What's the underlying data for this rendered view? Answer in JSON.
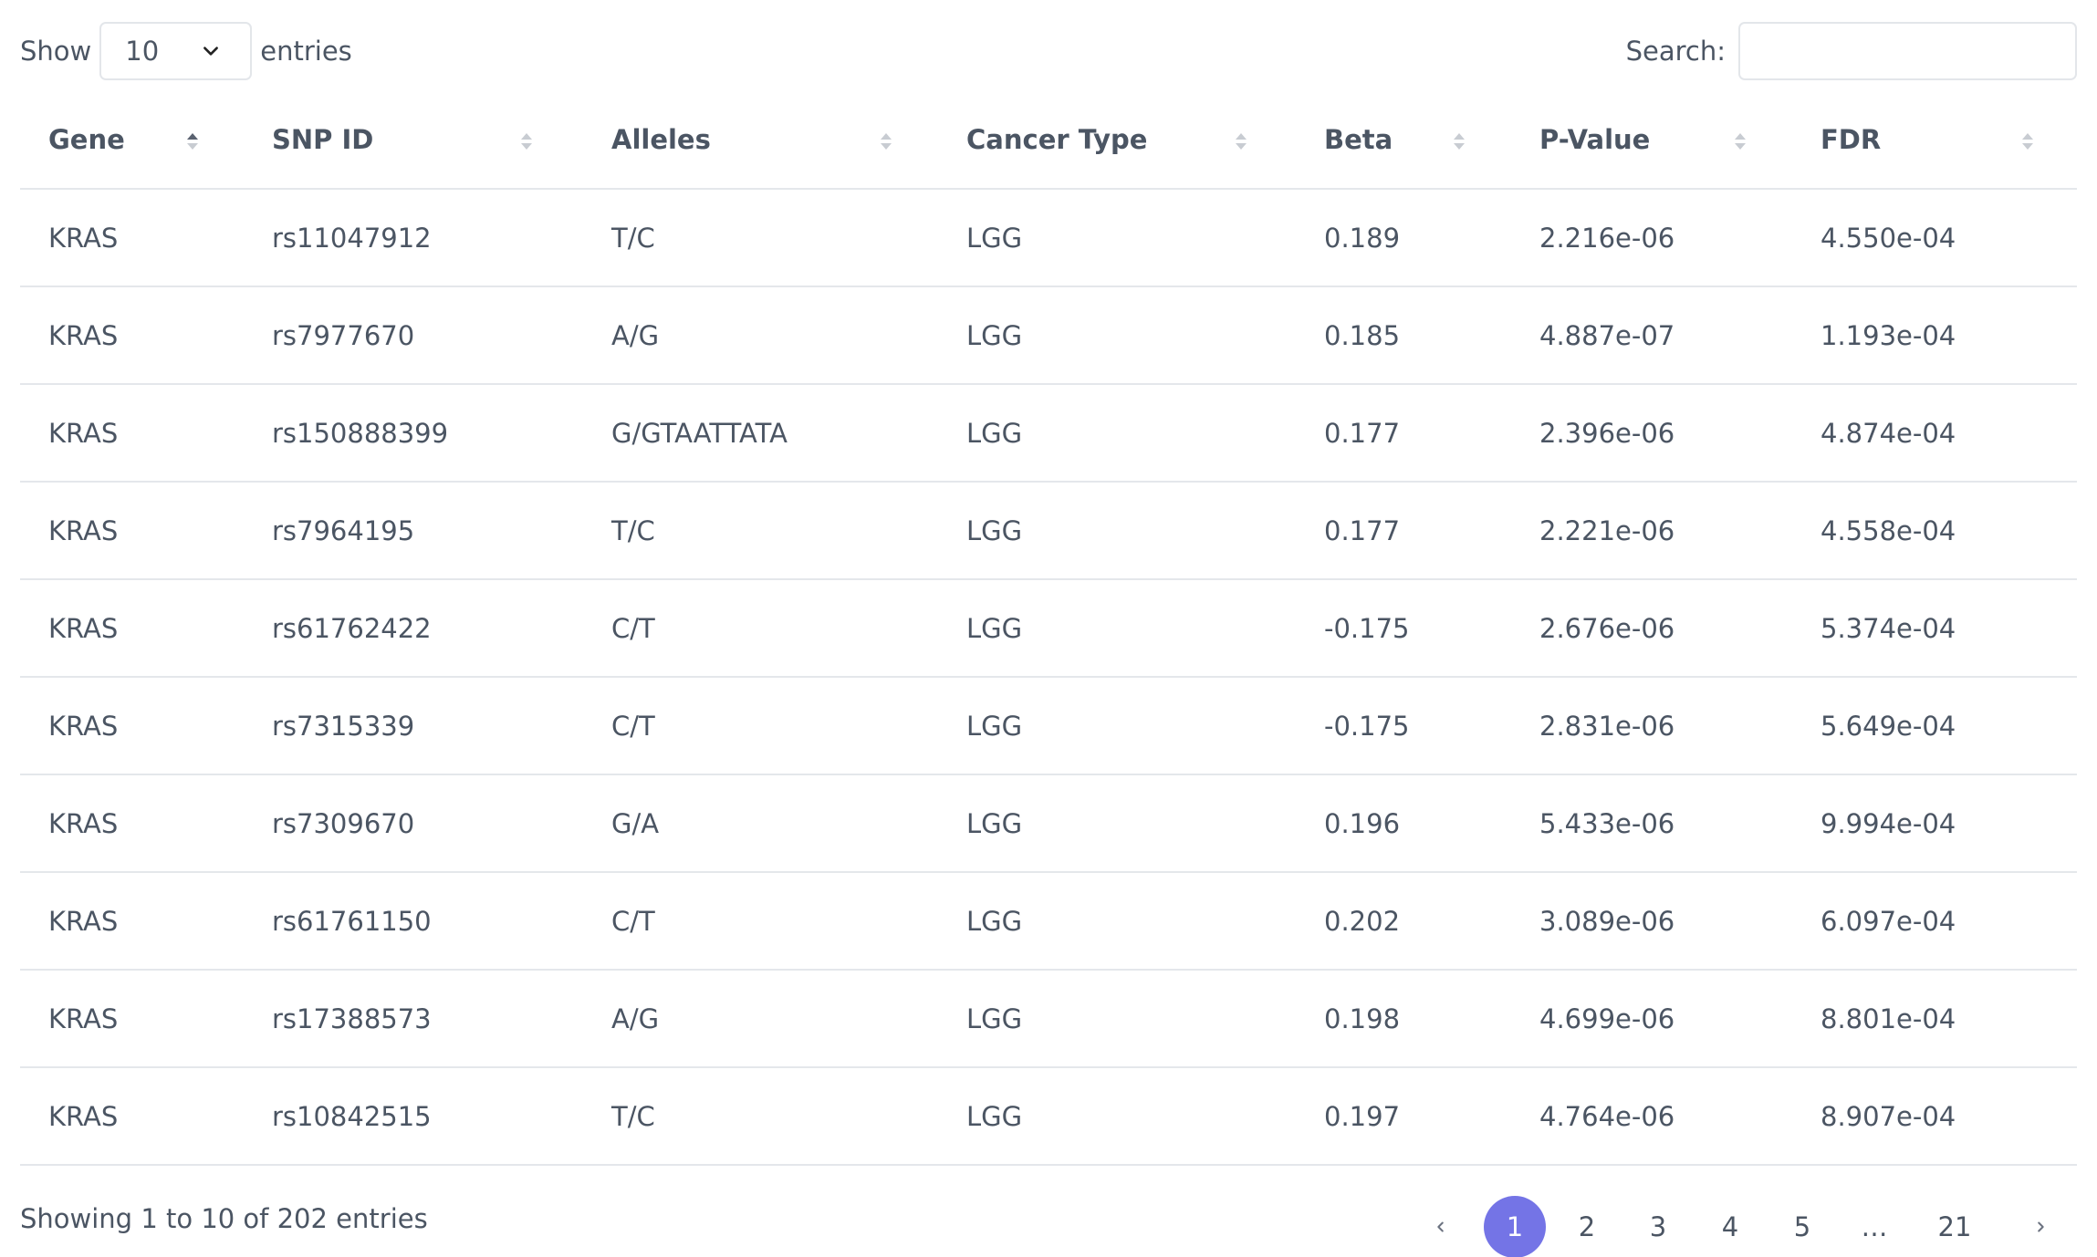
{
  "length": {
    "show_label": "Show",
    "value": "10",
    "entries_label": "entries"
  },
  "search": {
    "label": "Search:",
    "value": ""
  },
  "table": {
    "headers": [
      "Gene",
      "SNP ID",
      "Alleles",
      "Cancer Type",
      "Beta",
      "P-Value",
      "FDR"
    ],
    "sorted_column": "Gene",
    "rows": [
      [
        "KRAS",
        "rs11047912",
        "T/C",
        "LGG",
        "0.189",
        "2.216e-06",
        "4.550e-04"
      ],
      [
        "KRAS",
        "rs7977670",
        "A/G",
        "LGG",
        "0.185",
        "4.887e-07",
        "1.193e-04"
      ],
      [
        "KRAS",
        "rs150888399",
        "G/GTAATTATA",
        "LGG",
        "0.177",
        "2.396e-06",
        "4.874e-04"
      ],
      [
        "KRAS",
        "rs7964195",
        "T/C",
        "LGG",
        "0.177",
        "2.221e-06",
        "4.558e-04"
      ],
      [
        "KRAS",
        "rs61762422",
        "C/T",
        "LGG",
        "-0.175",
        "2.676e-06",
        "5.374e-04"
      ],
      [
        "KRAS",
        "rs7315339",
        "C/T",
        "LGG",
        "-0.175",
        "2.831e-06",
        "5.649e-04"
      ],
      [
        "KRAS",
        "rs7309670",
        "G/A",
        "LGG",
        "0.196",
        "5.433e-06",
        "9.994e-04"
      ],
      [
        "KRAS",
        "rs61761150",
        "C/T",
        "LGG",
        "0.202",
        "3.089e-06",
        "6.097e-04"
      ],
      [
        "KRAS",
        "rs17388573",
        "A/G",
        "LGG",
        "0.198",
        "4.699e-06",
        "8.801e-04"
      ],
      [
        "KRAS",
        "rs10842515",
        "T/C",
        "LGG",
        "0.197",
        "4.764e-06",
        "8.907e-04"
      ]
    ]
  },
  "info": "Showing 1 to 10 of 202 entries",
  "pagination": {
    "pages": [
      "1",
      "2",
      "3",
      "4",
      "5",
      "…",
      "21"
    ],
    "current": "1",
    "prev_icon": "chevron-left-icon",
    "next_icon": "chevron-right-icon"
  },
  "colors": {
    "accent": "#7474e6",
    "text": "#4b5563",
    "border": "#e4e7eb"
  }
}
